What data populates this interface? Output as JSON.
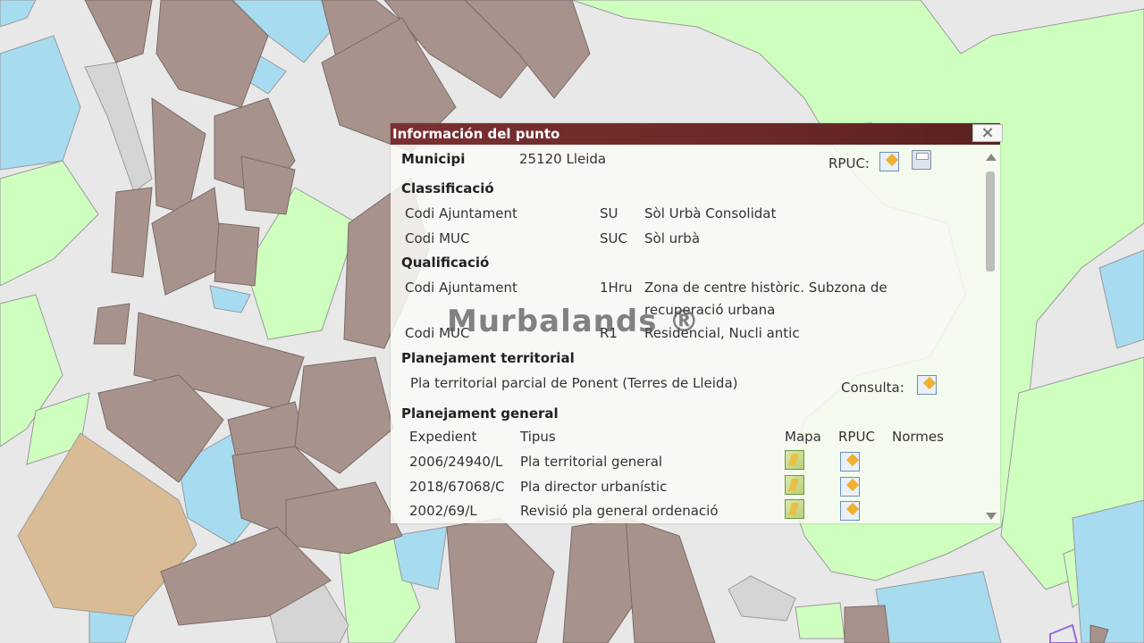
{
  "popup": {
    "title": "Información del punto",
    "close_label": "×",
    "municipi_label": "Municipi",
    "municipi_value": "25120 Lleida",
    "rpuc_label": "RPUC:",
    "classificacio": {
      "header": "Classificació",
      "rows": [
        {
          "label": "Codi Ajuntament",
          "code": "SU",
          "desc": "Sòl Urbà Consolidat"
        },
        {
          "label": "Codi MUC",
          "code": "SUC",
          "desc": "Sòl urbà"
        }
      ]
    },
    "qualificacio": {
      "header": "Qualificació",
      "rows": [
        {
          "label": "Codi Ajuntament",
          "code": "1Hru",
          "desc": "Zona de centre històric. Subzona de",
          "desc2": "recuperació urbana"
        },
        {
          "label": "Codi MUC",
          "code": "R1",
          "desc": "Residencial, Nucli antic"
        }
      ]
    },
    "territorial": {
      "header": "Planejament territorial",
      "text": "Pla territorial parcial de Ponent (Terres de Lleida)",
      "consulta_label": "Consulta:"
    },
    "general": {
      "header": "Planejament general",
      "columns": {
        "expedient": "Expedient",
        "tipus": "Tipus",
        "mapa": "Mapa",
        "rpuc": "RPUC",
        "normes": "Normes"
      },
      "rows": [
        {
          "expedient": "2006/24940/L",
          "tipus": "Pla territorial general"
        },
        {
          "expedient": "2018/67068/C",
          "tipus": "Pla director urbanístic"
        },
        {
          "expedient": "2002/69/L",
          "tipus": "Revisió pla general ordenació"
        }
      ]
    }
  },
  "watermark": "Murbalands ®",
  "icons": {
    "rpuc": "document-edit-icon",
    "print": "printer-icon",
    "map": "map-icon",
    "close": "close-icon"
  },
  "colors": {
    "title_bar": "#6b2828",
    "urban_block": "#a8928c",
    "green_zone": "#cfffbf",
    "water_zone": "#a7dbf0",
    "street": "#e8e8e8"
  }
}
